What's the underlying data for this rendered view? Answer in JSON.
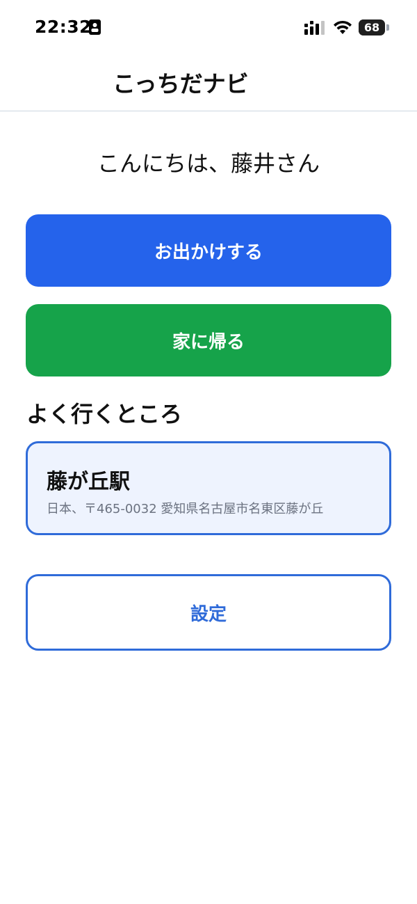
{
  "status_bar": {
    "time": "22:32",
    "battery_percent": "68",
    "battery_level": 0.68,
    "icons": [
      "id-badge-icon",
      "signal-icon",
      "wifi-icon",
      "battery-icon"
    ]
  },
  "header": {
    "title": "こっちだナビ"
  },
  "greeting": "こんにちは、藤井さん",
  "actions": {
    "go_out_label": "お出かけする",
    "go_home_label": "家に帰る"
  },
  "favorites": {
    "title": "よく行くところ",
    "items": [
      {
        "name": "藤が丘駅",
        "address": "日本、〒465-0032 愛知県名古屋市名東区藤が丘"
      }
    ]
  },
  "settings_label": "設定",
  "colors": {
    "go_out": "#2563eb",
    "go_home": "#16a34a",
    "accent_border": "#2f6bd9",
    "card_bg": "#eef3fe",
    "address_text": "#6b7280"
  }
}
